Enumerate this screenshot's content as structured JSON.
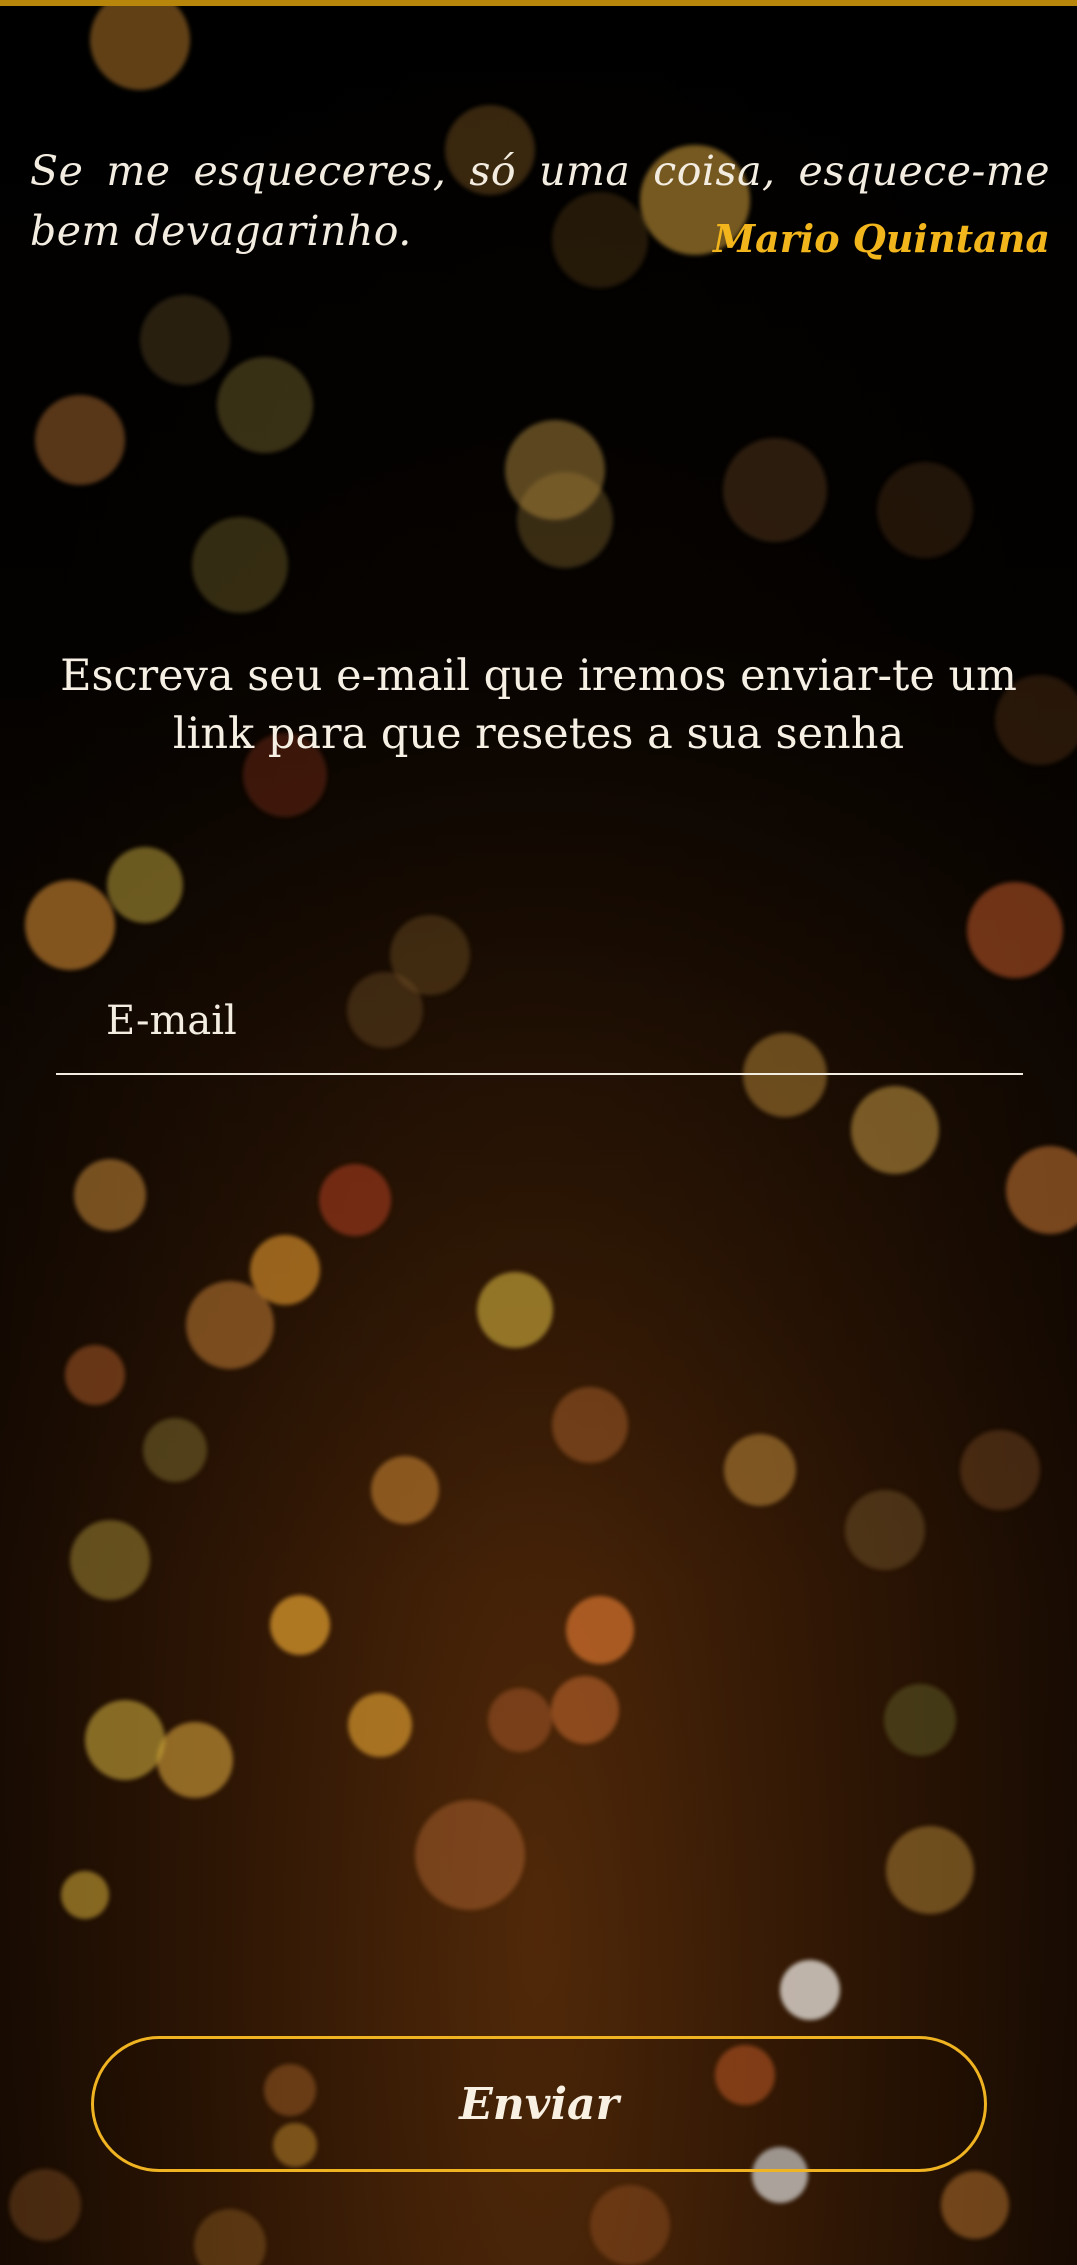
{
  "quote": {
    "text": "Se me esqueceres, só uma coisa, esquece-me bem devagarinho.",
    "author": "Mario Quintana"
  },
  "instructions": "Escreva seu e-mail que iremos enviar-te um link para que resetes a sua senha",
  "email": {
    "placeholder": "E-mail",
    "value": ""
  },
  "send_button": {
    "label": "Enviar"
  },
  "colors": {
    "accent": "#f2b61c",
    "top_strip": "#b8860b",
    "text": "#f3ece0",
    "background": "#050302"
  },
  "background_image": "golden-bokeh-lights"
}
